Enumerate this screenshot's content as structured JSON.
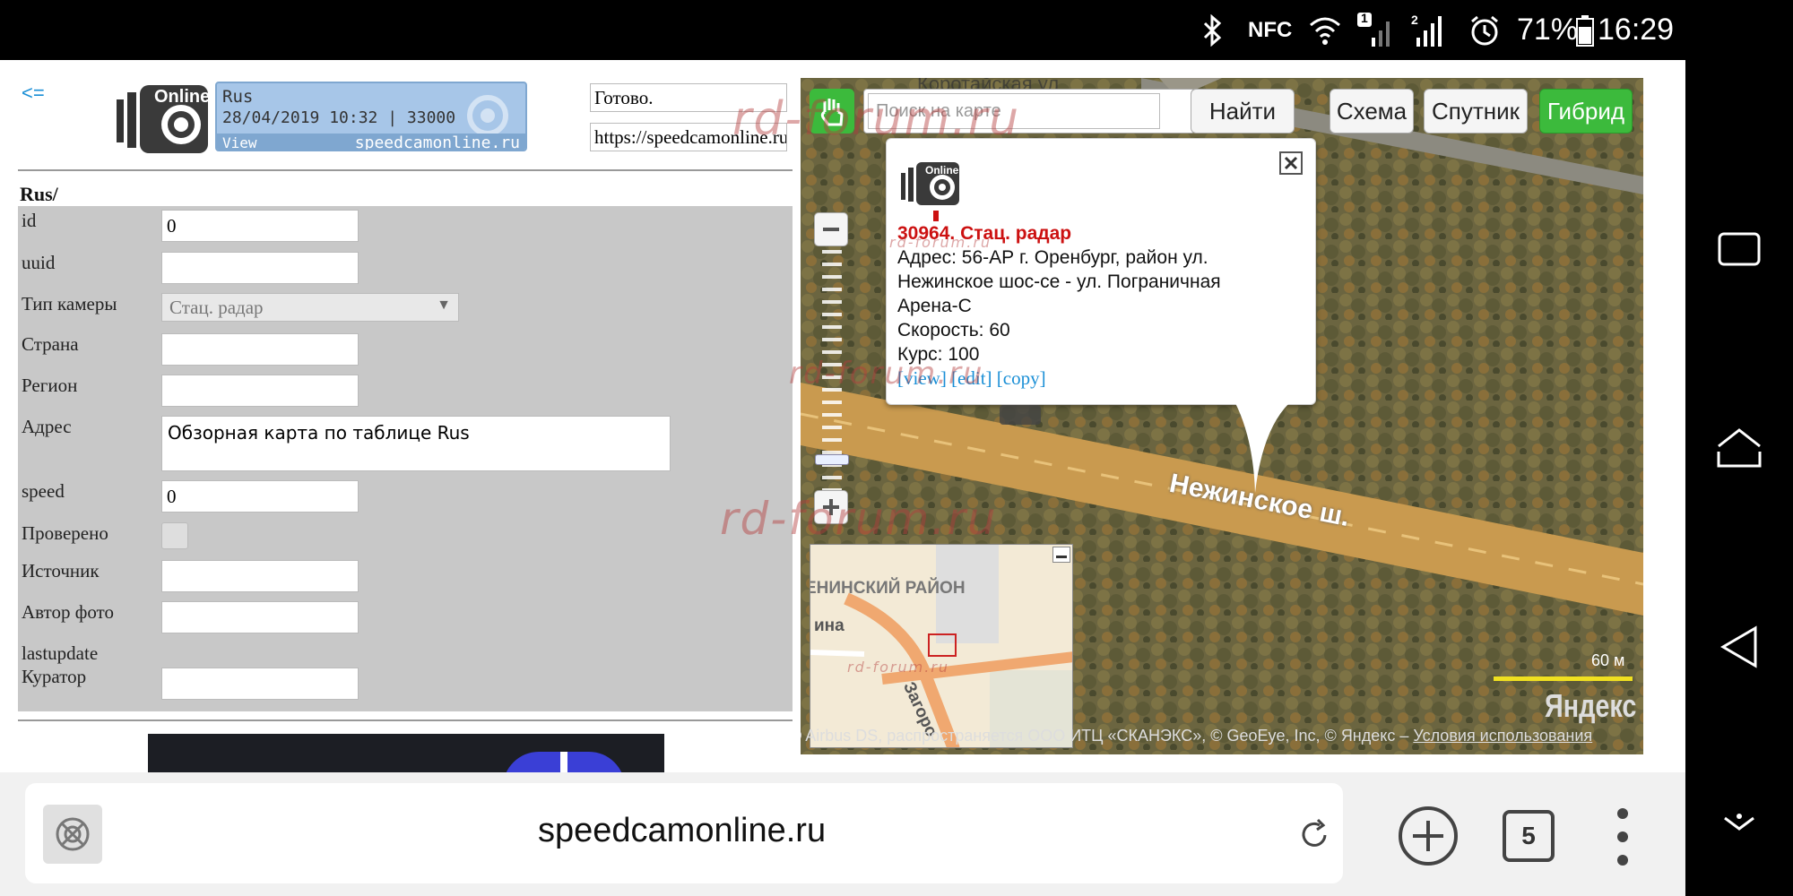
{
  "status": {
    "nfc": "NFC",
    "sim1": "1",
    "sim2": "2",
    "battery": "71%",
    "time": "16:29",
    "icons": [
      "bluetooth-icon",
      "nfc-icon",
      "wifi-icon",
      "signal-icon",
      "alarm-icon",
      "battery-icon"
    ]
  },
  "header": {
    "back": "<=",
    "banner": {
      "logo_word": "Online",
      "country": "Rus",
      "date_line": "28/04/2019 10:32 | 33000",
      "view": "View",
      "site": "speedcamonline.ru"
    },
    "status_text": "Готово.",
    "url_text": "https://speedcamonline.ru"
  },
  "form": {
    "section_title": "Rus/",
    "fields": [
      {
        "label": "id",
        "value": "0"
      },
      {
        "label": "uuid",
        "value": ""
      },
      {
        "label": "Тип камеры",
        "value": "Стац. радар"
      },
      {
        "label": "Страна",
        "value": ""
      },
      {
        "label": "Регион",
        "value": ""
      },
      {
        "label": "Адрес",
        "value": "Обзорная карта по таблице Rus"
      },
      {
        "label": "speed",
        "value": "0"
      },
      {
        "label": "Проверено",
        "value": ""
      },
      {
        "label": "Источник",
        "value": ""
      },
      {
        "label": "Автор фото",
        "value": ""
      },
      {
        "label": "lastupdate",
        "value": ""
      },
      {
        "label": "Куратор",
        "value": ""
      }
    ]
  },
  "map": {
    "search_placeholder": "Поиск на карте",
    "search_button": "Найти",
    "modes": [
      "Схема",
      "Спутник",
      "Гибрид"
    ],
    "active_mode": "Гибрид",
    "top_street": "Коротайская ул",
    "road_label": "Нежинское ш.",
    "popup": {
      "title": "30964. Стац. радар",
      "address_lines": [
        "Адрес: 56-АР г. Оренбург, район ул.",
        "Нежинское шос-се - ул. Пограничная",
        "Арена-С"
      ],
      "speed": "Скорость: 60",
      "course": "Курс: 100",
      "links": [
        "[view]",
        "[edit]",
        "[copy]"
      ],
      "logo_word": "Online"
    },
    "minimap": {
      "district": "ЕНИНСКИЙ РАЙОН",
      "label_left": "ина",
      "label_road": "Загоро"
    },
    "scale": "60 м",
    "brand": "Яндекс",
    "copyright": "© Airbus DS, распространяется ООО ИТЦ «СКАНЭКС», © GeoEye, Inc, © Яндекс –",
    "terms": "Условия использования"
  },
  "watermarks": [
    "rd-forum.ru",
    "rd-forum.ru",
    "rd-forum.ru",
    "rd-forum.ru",
    "rd-forum.ru",
    "rd-forum.ru"
  ],
  "browser": {
    "url": "speedcamonline.ru",
    "tabs_count": "5"
  },
  "colors": {
    "link_blue": "#1a8fd6",
    "popup_title_red": "#cc1111",
    "active_mode_green": "#3cba3c",
    "form_bg": "#c8c8c8",
    "road_orange": "#c99a4f"
  }
}
